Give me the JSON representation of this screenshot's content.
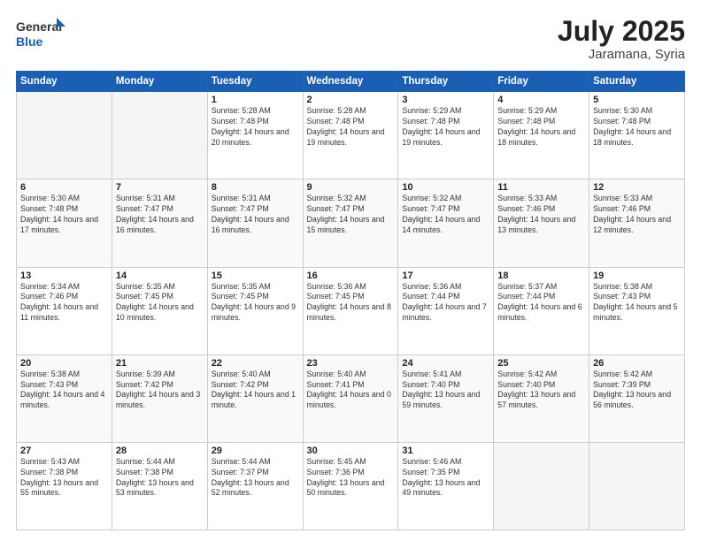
{
  "header": {
    "logo_general": "General",
    "logo_blue": "Blue",
    "title": "July 2025",
    "location": "Jaramana, Syria"
  },
  "days_of_week": [
    "Sunday",
    "Monday",
    "Tuesday",
    "Wednesday",
    "Thursday",
    "Friday",
    "Saturday"
  ],
  "weeks": [
    [
      {
        "day": "",
        "info": ""
      },
      {
        "day": "",
        "info": ""
      },
      {
        "day": "1",
        "info": "Sunrise: 5:28 AM\nSunset: 7:48 PM\nDaylight: 14 hours and 20 minutes."
      },
      {
        "day": "2",
        "info": "Sunrise: 5:28 AM\nSunset: 7:48 PM\nDaylight: 14 hours and 19 minutes."
      },
      {
        "day": "3",
        "info": "Sunrise: 5:29 AM\nSunset: 7:48 PM\nDaylight: 14 hours and 19 minutes."
      },
      {
        "day": "4",
        "info": "Sunrise: 5:29 AM\nSunset: 7:48 PM\nDaylight: 14 hours and 18 minutes."
      },
      {
        "day": "5",
        "info": "Sunrise: 5:30 AM\nSunset: 7:48 PM\nDaylight: 14 hours and 18 minutes."
      }
    ],
    [
      {
        "day": "6",
        "info": "Sunrise: 5:30 AM\nSunset: 7:48 PM\nDaylight: 14 hours and 17 minutes."
      },
      {
        "day": "7",
        "info": "Sunrise: 5:31 AM\nSunset: 7:47 PM\nDaylight: 14 hours and 16 minutes."
      },
      {
        "day": "8",
        "info": "Sunrise: 5:31 AM\nSunset: 7:47 PM\nDaylight: 14 hours and 16 minutes."
      },
      {
        "day": "9",
        "info": "Sunrise: 5:32 AM\nSunset: 7:47 PM\nDaylight: 14 hours and 15 minutes."
      },
      {
        "day": "10",
        "info": "Sunrise: 5:32 AM\nSunset: 7:47 PM\nDaylight: 14 hours and 14 minutes."
      },
      {
        "day": "11",
        "info": "Sunrise: 5:33 AM\nSunset: 7:46 PM\nDaylight: 14 hours and 13 minutes."
      },
      {
        "day": "12",
        "info": "Sunrise: 5:33 AM\nSunset: 7:46 PM\nDaylight: 14 hours and 12 minutes."
      }
    ],
    [
      {
        "day": "13",
        "info": "Sunrise: 5:34 AM\nSunset: 7:46 PM\nDaylight: 14 hours and 11 minutes."
      },
      {
        "day": "14",
        "info": "Sunrise: 5:35 AM\nSunset: 7:45 PM\nDaylight: 14 hours and 10 minutes."
      },
      {
        "day": "15",
        "info": "Sunrise: 5:35 AM\nSunset: 7:45 PM\nDaylight: 14 hours and 9 minutes."
      },
      {
        "day": "16",
        "info": "Sunrise: 5:36 AM\nSunset: 7:45 PM\nDaylight: 14 hours and 8 minutes."
      },
      {
        "day": "17",
        "info": "Sunrise: 5:36 AM\nSunset: 7:44 PM\nDaylight: 14 hours and 7 minutes."
      },
      {
        "day": "18",
        "info": "Sunrise: 5:37 AM\nSunset: 7:44 PM\nDaylight: 14 hours and 6 minutes."
      },
      {
        "day": "19",
        "info": "Sunrise: 5:38 AM\nSunset: 7:43 PM\nDaylight: 14 hours and 5 minutes."
      }
    ],
    [
      {
        "day": "20",
        "info": "Sunrise: 5:38 AM\nSunset: 7:43 PM\nDaylight: 14 hours and 4 minutes."
      },
      {
        "day": "21",
        "info": "Sunrise: 5:39 AM\nSunset: 7:42 PM\nDaylight: 14 hours and 3 minutes."
      },
      {
        "day": "22",
        "info": "Sunrise: 5:40 AM\nSunset: 7:42 PM\nDaylight: 14 hours and 1 minute."
      },
      {
        "day": "23",
        "info": "Sunrise: 5:40 AM\nSunset: 7:41 PM\nDaylight: 14 hours and 0 minutes."
      },
      {
        "day": "24",
        "info": "Sunrise: 5:41 AM\nSunset: 7:40 PM\nDaylight: 13 hours and 59 minutes."
      },
      {
        "day": "25",
        "info": "Sunrise: 5:42 AM\nSunset: 7:40 PM\nDaylight: 13 hours and 57 minutes."
      },
      {
        "day": "26",
        "info": "Sunrise: 5:42 AM\nSunset: 7:39 PM\nDaylight: 13 hours and 56 minutes."
      }
    ],
    [
      {
        "day": "27",
        "info": "Sunrise: 5:43 AM\nSunset: 7:38 PM\nDaylight: 13 hours and 55 minutes."
      },
      {
        "day": "28",
        "info": "Sunrise: 5:44 AM\nSunset: 7:38 PM\nDaylight: 13 hours and 53 minutes."
      },
      {
        "day": "29",
        "info": "Sunrise: 5:44 AM\nSunset: 7:37 PM\nDaylight: 13 hours and 52 minutes."
      },
      {
        "day": "30",
        "info": "Sunrise: 5:45 AM\nSunset: 7:36 PM\nDaylight: 13 hours and 50 minutes."
      },
      {
        "day": "31",
        "info": "Sunrise: 5:46 AM\nSunset: 7:35 PM\nDaylight: 13 hours and 49 minutes."
      },
      {
        "day": "",
        "info": ""
      },
      {
        "day": "",
        "info": ""
      }
    ]
  ]
}
